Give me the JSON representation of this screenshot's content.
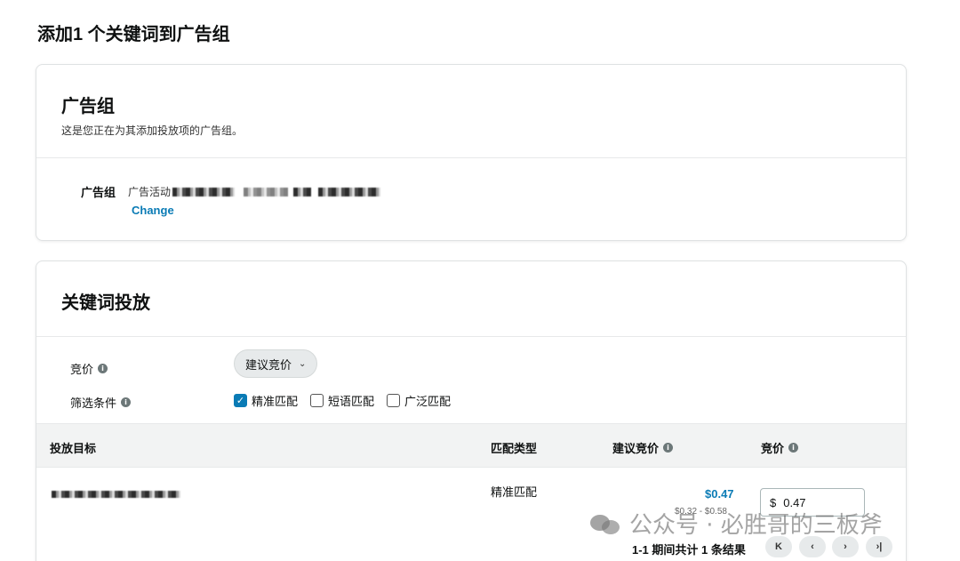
{
  "page": {
    "title": "添加1 个关键词到广告组"
  },
  "ad_group_card": {
    "title": "广告组",
    "subtitle": "这是您正在为其添加投放项的广告组。",
    "label": "广告组",
    "campaign_prefix": "广告活动",
    "change_link": "Change"
  },
  "keyword_card": {
    "title": "关键词投放",
    "bid_label": "竞价",
    "bid_dropdown": "建议竞价",
    "filter_label": "筛选条件",
    "filters": [
      {
        "label": "精准匹配",
        "checked": true
      },
      {
        "label": "短语匹配",
        "checked": false
      },
      {
        "label": "广泛匹配",
        "checked": false
      }
    ]
  },
  "table": {
    "headers": {
      "target": "投放目标",
      "match_type": "匹配类型",
      "suggested_bid": "建议竞价",
      "bid": "竞价"
    },
    "rows": [
      {
        "match_type": "精准匹配",
        "suggested_bid": "$0.47",
        "suggested_range": "$0.32 - $0.58",
        "bid_currency": "$",
        "bid_value": "0.47"
      }
    ]
  },
  "pagination": {
    "summary": "1-1 期间共计 1 条结果",
    "first_icon": "first-page-icon",
    "prev_icon": "prev-page-icon",
    "next_icon": "next-page-icon",
    "last_icon": "last-page-icon"
  },
  "watermark": {
    "text": "公众号 · 必胜哥的三板斧",
    "icon": "wechat-icon"
  },
  "colors": {
    "link": "#0a7bb5",
    "checkbox": "#0a7bb5",
    "table_header_bg": "#f2f3f3"
  }
}
